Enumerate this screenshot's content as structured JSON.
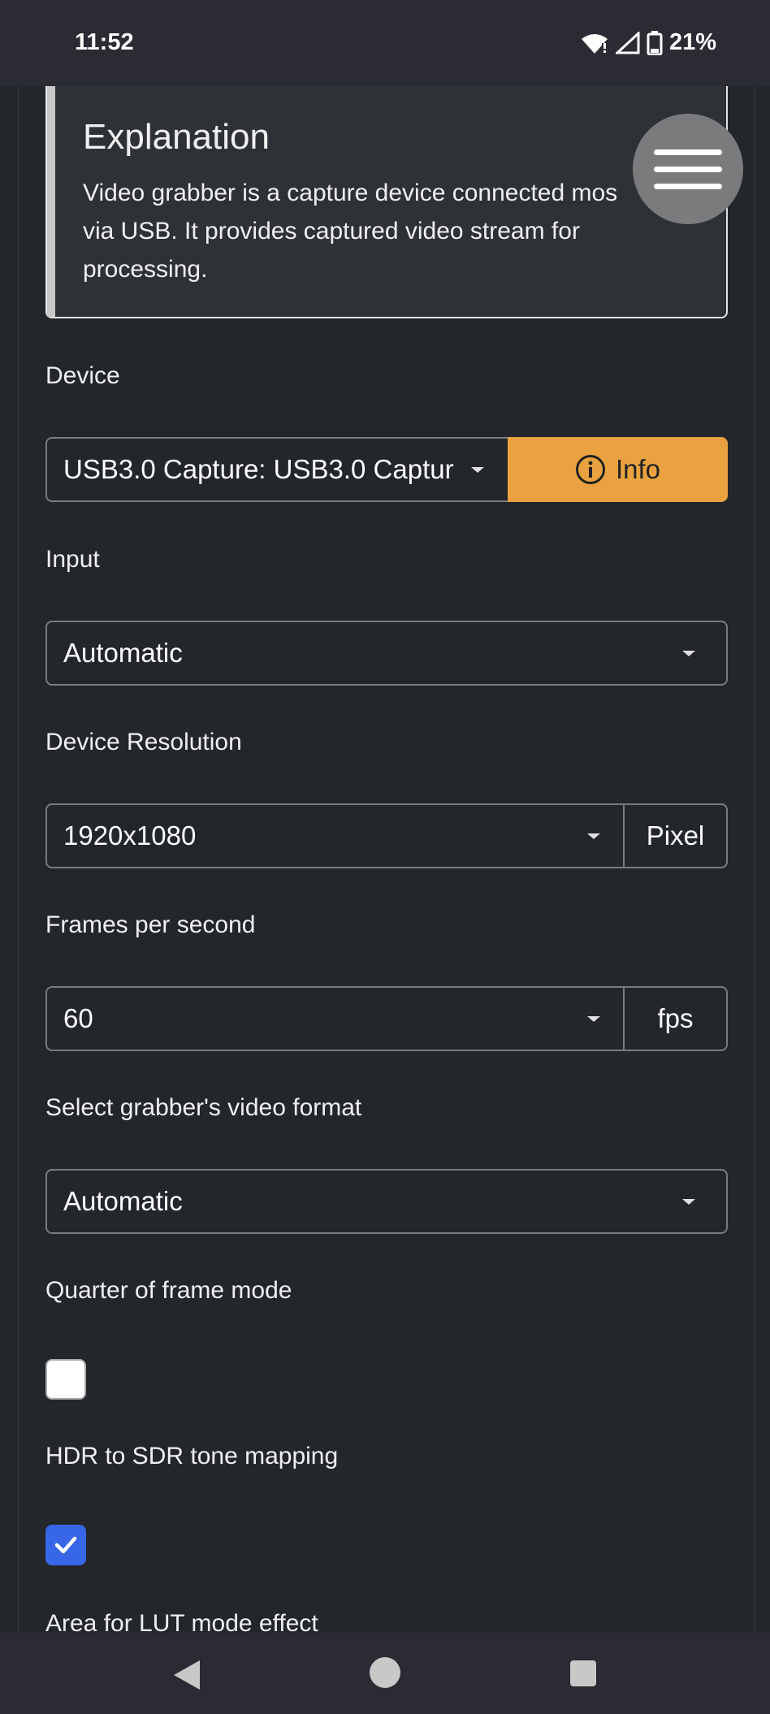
{
  "status": {
    "time": "11:52",
    "battery": "21%"
  },
  "explanation": {
    "title": "Explanation",
    "text": "Video grabber is a capture device connected mos\nvia USB. It provides captured video stream for\nprocessing."
  },
  "fields": {
    "device": {
      "label": "Device",
      "value": "USB3.0 Capture: USB3.0 Captur",
      "button": "Info"
    },
    "input": {
      "label": "Input",
      "value": "Automatic"
    },
    "resolution": {
      "label": "Device Resolution",
      "value": "1920x1080",
      "unit": "Pixel"
    },
    "fps": {
      "label": "Frames per second",
      "value": "60",
      "unit": "fps"
    },
    "format": {
      "label": "Select grabber's video format",
      "value": "Automatic"
    },
    "quarter": {
      "label": "Quarter of frame mode",
      "checked": false
    },
    "hdr": {
      "label": "HDR to SDR tone mapping",
      "checked": true
    },
    "lut": {
      "label": "Area for LUT mode effect"
    }
  },
  "colors": {
    "background": "#23262b",
    "accent_info": "#e9a23f",
    "checkbox_checked": "#3767e6"
  },
  "icons": [
    "wifi-icon",
    "signal-icon",
    "battery-icon",
    "menu-icon",
    "info-icon",
    "check-icon",
    "back-icon",
    "home-icon",
    "recents-icon"
  ]
}
